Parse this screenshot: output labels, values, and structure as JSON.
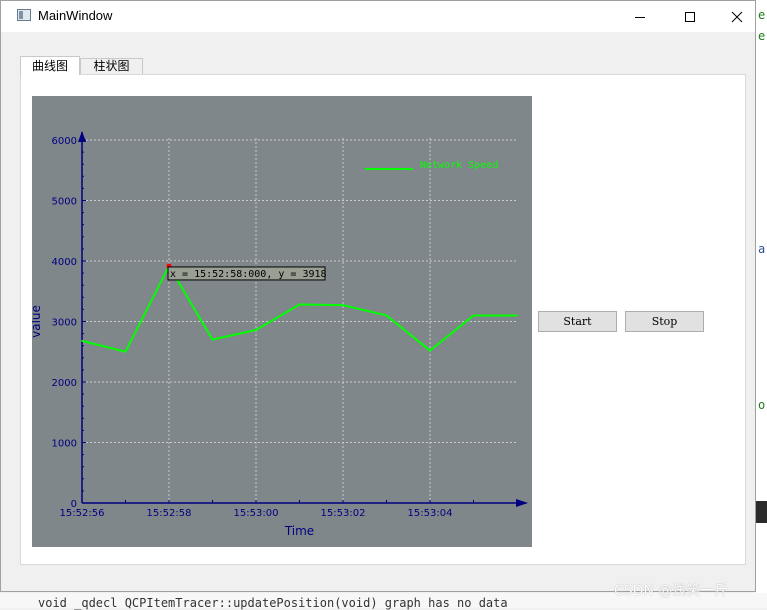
{
  "window": {
    "title": "MainWindow"
  },
  "tabs": [
    {
      "label": "曲线图",
      "active": true
    },
    {
      "label": "柱状图",
      "active": false
    }
  ],
  "buttons": {
    "start_label": "Start",
    "stop_label": "Stop"
  },
  "watermark": "CSDN @浅笑一斤",
  "background_code_line": "void  _qdecl QCPItemTracer::updatePosition(void) graph has no data",
  "chart_data": {
    "type": "line",
    "xlabel": "Time",
    "ylabel": "value",
    "ylim": [
      0,
      6000
    ],
    "yticks": [
      0,
      1000,
      2000,
      3000,
      4000,
      5000,
      6000
    ],
    "xlim_seconds_label_range": [
      "15:52:56",
      "15:53:06"
    ],
    "x_tick_labels": [
      "15:52:56",
      "15:52:58",
      "15:53:00",
      "15:53:02",
      "15:53:04"
    ],
    "x": [
      "15:52:56",
      "15:52:57",
      "15:52:58",
      "15:52:59",
      "15:53:00",
      "15:53:01",
      "15:53:02",
      "15:53:03",
      "15:53:04",
      "15:53:05",
      "15:53:06"
    ],
    "series": [
      {
        "name": "Network Speed",
        "color": "#00ff00",
        "values": [
          2680,
          2500,
          3918,
          2700,
          2860,
          3280,
          3270,
          3100,
          2520,
          3100,
          3100
        ]
      }
    ],
    "tracer": {
      "label": "x = 15:52:58:000, y = 3918",
      "x": "15:52:58",
      "y": 3918,
      "color": "#ff0000"
    },
    "background_color": "#80878a",
    "axis_color": "#000080",
    "grid": true,
    "legend_position": "top-right"
  }
}
